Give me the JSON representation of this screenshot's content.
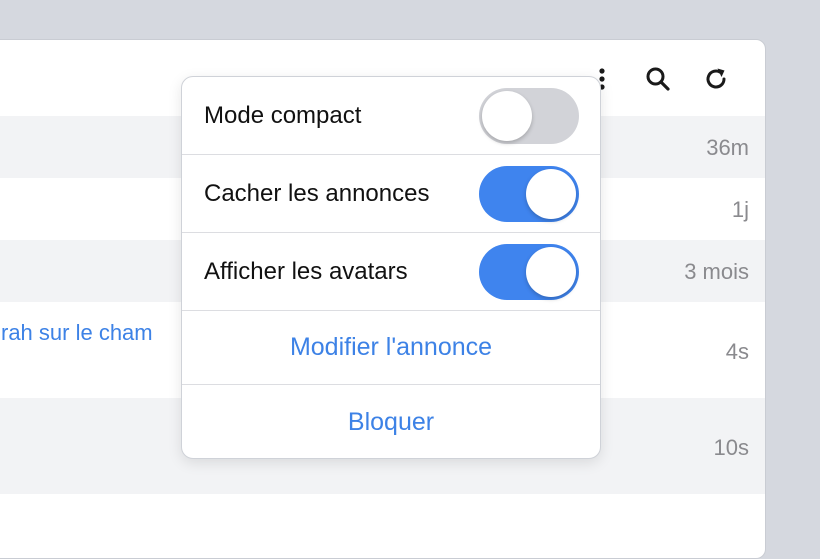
{
  "toolbar": {
    "icons": [
      "more-vertical-icon",
      "search-icon",
      "refresh-icon"
    ]
  },
  "feed": {
    "rows": [
      {
        "time": "36m"
      },
      {
        "time": "1j"
      },
      {
        "time": "3 mois"
      },
      {
        "link": "rah sur le cham",
        "time": "4s"
      },
      {
        "time": "10s"
      }
    ]
  },
  "menu": {
    "toggles": [
      {
        "label": "Mode compact",
        "state": "off"
      },
      {
        "label": "Cacher les annonces",
        "state": "on"
      },
      {
        "label": "Afficher les avatars",
        "state": "on"
      }
    ],
    "actions": [
      {
        "label": "Modifier l'annonce"
      },
      {
        "label": "Bloquer"
      }
    ]
  },
  "colors": {
    "accent": "#3d82e6",
    "toggle_on": "#3f84ee",
    "toggle_off": "#d2d3d8",
    "backdrop": "#d5d8df"
  }
}
